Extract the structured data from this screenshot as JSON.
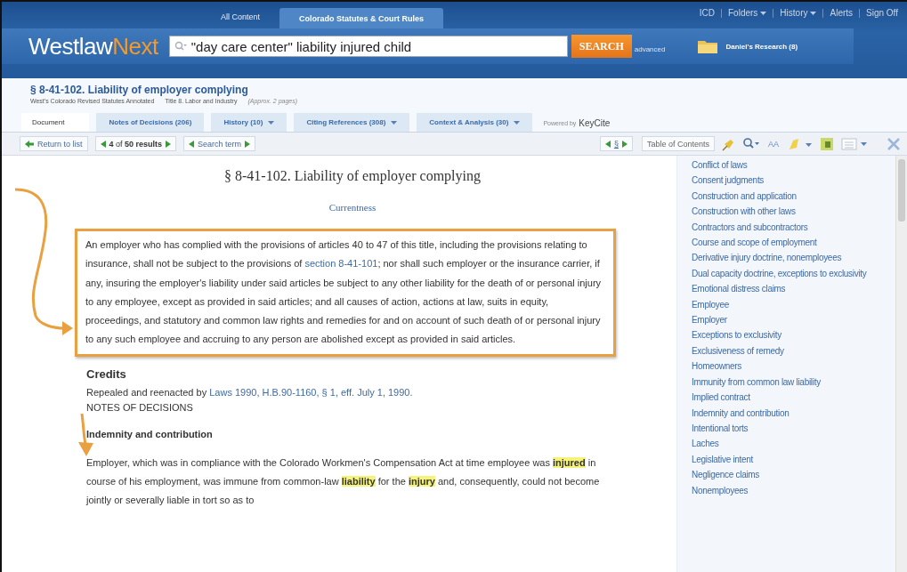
{
  "header": {
    "top_links": [
      {
        "label": "ICD",
        "caret": false
      },
      {
        "label": "Folders",
        "caret": true
      },
      {
        "label": "History",
        "caret": true
      },
      {
        "label": "Alerts",
        "caret": false
      },
      {
        "label": "Sign Off",
        "caret": false
      }
    ],
    "scope_tabs": [
      {
        "label": "All Content",
        "selected": false
      },
      {
        "label": "Colorado Statutes & Court Rules",
        "selected": true
      }
    ],
    "logo": {
      "part1": "Westlaw",
      "part2": "Next"
    },
    "search": {
      "value": "\"day care center\" liability injured child",
      "button": "SEARCH",
      "advanced": "advanced"
    },
    "folder": {
      "label": "Daniel's Research (8)"
    }
  },
  "document_header": {
    "title": "§ 8-41-102. Liability of employer complying",
    "source": "West's Colorado Revised Statutes Annotated",
    "title_path": "Title 8. Labor and Industry",
    "length": "(Approx. 2 pages)"
  },
  "doc_tabs": [
    {
      "label": "Document",
      "selected": true,
      "caret": false
    },
    {
      "label": "Notes of Decisions (206)",
      "selected": false,
      "caret": false
    },
    {
      "label": "History (10)",
      "selected": false,
      "caret": true
    },
    {
      "label": "Citing References (308)",
      "selected": false,
      "caret": true
    },
    {
      "label": "Context & Analysis (30)",
      "selected": false,
      "caret": true
    }
  ],
  "powered_by": {
    "prefix": "Powered by",
    "brand": "KeyCite"
  },
  "toolbar": {
    "return": "Return to list",
    "results": {
      "prefix": "4",
      "middle": "of",
      "count": "50 results"
    },
    "search_term": "Search term",
    "section": "§",
    "toc": "Table of Contents",
    "text_size": "AA"
  },
  "document": {
    "heading": "§ 8-41-102. Liability of employer complying",
    "currentness": "Currentness",
    "statute_text": [
      {
        "kind": "text",
        "text": "An employer who has complied with the provisions of articles 40 to 47 of this title, including the provisions relating to insurance, shall not be subject to the provisions of "
      },
      {
        "kind": "link",
        "text": "section 8-41-101"
      },
      {
        "kind": "text",
        "text": "; nor shall such employer or the insurance carrier, if any, insuring the employer's liability under said articles be subject to any other liability for the death of or personal injury to any employee, except as provided in said articles; and all causes of action, actions at law, suits in equity, proceedings, and statutory and common law rights and remedies for and on account of such death of or personal injury to any such employee and accruing to any person are abolished except as provided in said articles."
      }
    ],
    "credits_heading": "Credits",
    "credits_text": [
      {
        "kind": "text",
        "text": "Repealed and reenacted by "
      },
      {
        "kind": "link",
        "text": "Laws 1990, H.B.90-1160, § 1, eff. July 1, 1990."
      }
    ],
    "notes_heading": "NOTES OF DECISIONS",
    "note_title": "Indemnity and contribution",
    "note_text": [
      {
        "kind": "text",
        "text": "Employer, which was in compliance with the Colorado Workmen's Compensation Act at time employee was "
      },
      {
        "kind": "hit",
        "text": "injured"
      },
      {
        "kind": "text",
        "text": " in course of his employment, was immune from common-law "
      },
      {
        "kind": "hit",
        "text": "liability"
      },
      {
        "kind": "text",
        "text": " for the "
      },
      {
        "kind": "hit",
        "text": "injury"
      },
      {
        "kind": "text",
        "text": " and, consequently, could not become jointly or severally liable in tort so as to"
      }
    ]
  },
  "notes_index": [
    "Conflict of laws",
    "Consent judgments",
    "Construction and application",
    "Construction with other laws",
    "Contractors and subcontractors",
    "Course and scope of employment",
    "Derivative injury doctrine, nonemployees",
    "Dual capacity doctrine, exceptions to exclusivity",
    "Emotional distress claims",
    "Employee",
    "Employer",
    "Exceptions to exclusivity",
    "Exclusiveness of remedy",
    "Homeowners",
    "Immunity from common law liability",
    "Implied contract",
    "Indemnity and contribution",
    "Intentional torts",
    "Laches",
    "Legislative intent",
    "Negligence claims",
    "Nonemployees"
  ]
}
